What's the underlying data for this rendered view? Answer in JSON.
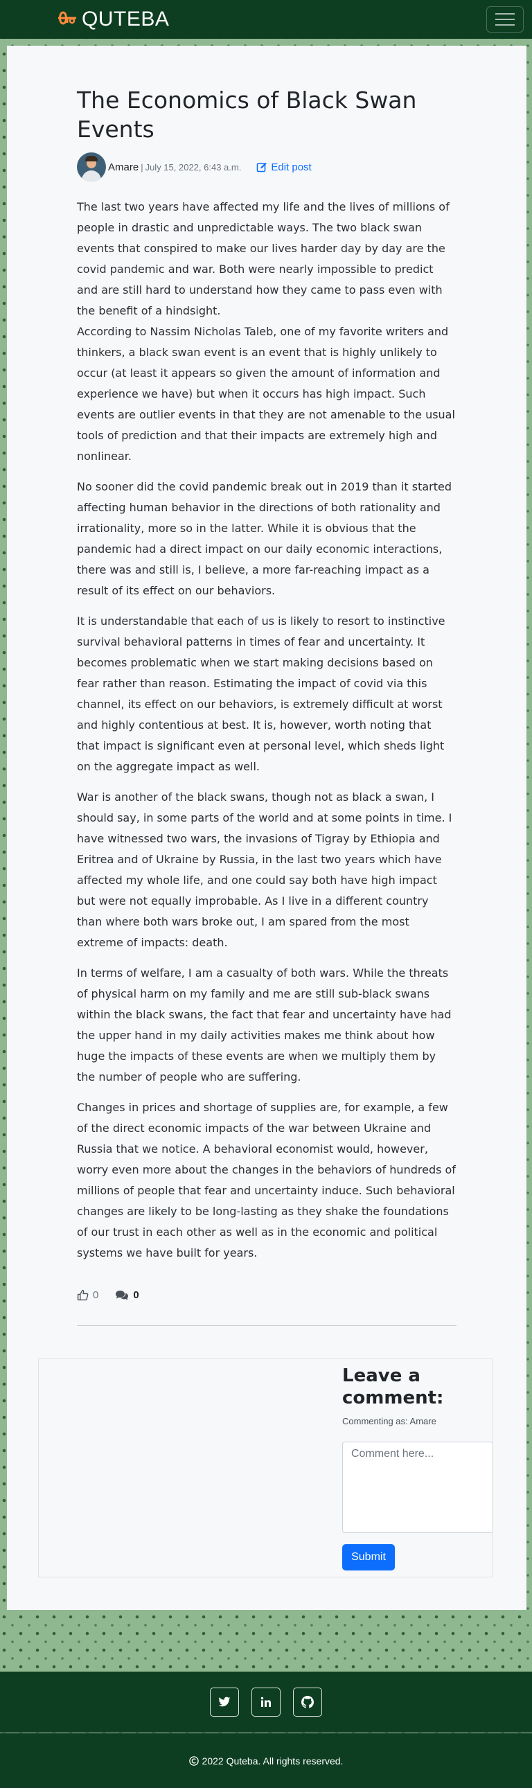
{
  "nav": {
    "brand_name": "QUTEBA",
    "logo_icon": "quteba-logo-icon",
    "menu_icon": "hamburger-menu-icon"
  },
  "post": {
    "title": "The Economics of Black Swan Events",
    "author": "Amare",
    "separator": "|",
    "date": "July 15, 2022, 6:43 a.m.",
    "edit_label": "Edit post",
    "paragraphs": [
      "The last two years have affected my life and the lives of millions of people in drastic and unpredictable ways. The two black swan events that conspired to make our lives harder day by day are the covid pandemic and war. Both were nearly impossible to predict and are still hard to understand how they came to pass even with the benefit of a hindsight.",
      "According to Nassim Nicholas Taleb, one of my favorite writers and thinkers, a black swan event is an event that is highly unlikely to occur (at least it appears so given the amount of information and experience we have) but when it occurs has high impact. Such events are outlier events in that they are not amenable to the usual tools of prediction and that their impacts are extremely high and nonlinear.",
      "No sooner did the covid pandemic break out in 2019 than it started affecting human behavior in the directions of both rationality and irrationality, more so in the latter. While it is obvious that the pandemic had a direct impact on our daily economic interactions, there was and still is, I believe, a more far-reaching impact as a result of its effect on our behaviors.",
      "It is understandable that each of us is likely to resort to instinctive survival behavioral patterns in times of fear and uncertainty. It becomes problematic when we start making decisions based on fear rather than reason. Estimating the impact of covid via this channel, its effect on our behaviors, is extremely difficult at worst and highly contentious at best. It is, however, worth noting that that impact is significant even at personal level, which sheds light on the aggregate impact as well.",
      "War is another of the black swans, though not as black a swan, I should say, in some parts of the world and at some points in time. I have witnessed two wars, the invasions of Tigray by Ethiopia and Eritrea and of Ukraine by Russia, in the last two years which have affected my whole life, and one could say both have high impact but were not equally improbable. As I live in a different country than where both wars broke out, I am spared from the most extreme of impacts: death.",
      "In terms of welfare, I am a casualty of both wars. While the threats of physical harm on my family and me are still sub-black swans within the black swans, the fact that fear and uncertainty have had the upper hand in my daily activities makes me think about how huge the impacts of these events are when we multiply them by the number of people who are suffering.",
      "Changes in prices and shortage of supplies are, for example, a few of the direct economic impacts of the war between Ukraine and Russia that we notice. A behavioral economist would, however, worry even more about the changes in the behaviors of hundreds of millions of people that fear and uncertainty induce. Such behavioral changes are likely to be long-lasting as they shake the foundations of our trust in each other as well as in the economic and political systems we have built for years."
    ],
    "likes": "0",
    "comments": "0"
  },
  "comment_form": {
    "title": "Leave a comment:",
    "commenting_as": "Commenting as: Amare",
    "placeholder": "Comment here...",
    "submit_label": "Submit"
  },
  "footer": {
    "social_icons": [
      "twitter-icon",
      "linkedin-icon",
      "github-icon"
    ],
    "copyright": "2022 Quteba. All rights reserved."
  },
  "colors": {
    "nav_bg": "#0e3e22",
    "accent": "#0d6efd",
    "logo": "#ff8a3d",
    "page_pattern": "#8fb890"
  }
}
